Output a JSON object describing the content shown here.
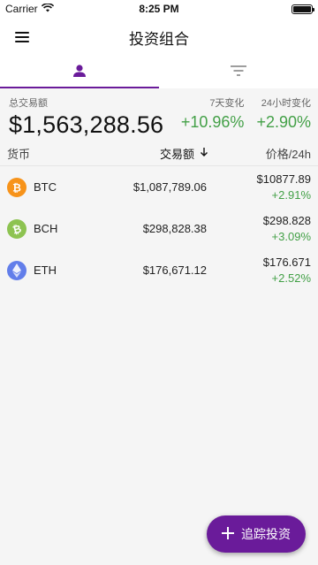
{
  "status_bar": {
    "carrier": "Carrier",
    "time": "8:25 PM"
  },
  "app_bar": {
    "title": "投资组合"
  },
  "tabs": [
    {
      "icon": "person-icon",
      "active": true
    },
    {
      "icon": "filter-icon",
      "active": false
    }
  ],
  "summary": {
    "total_label": "总交易额",
    "total_value": "$1,563,288.56",
    "change_7d_label": "7天变化",
    "change_7d_value": "+10.96%",
    "change_24h_label": "24小时变化",
    "change_24h_value": "+2.90%"
  },
  "table": {
    "headers": {
      "coin": "货币",
      "volume": "交易额",
      "price": "价格/24h"
    },
    "rows": [
      {
        "symbol": "BTC",
        "volume": "$1,087,789.06",
        "price": "$10877.89",
        "change": "+2.91%",
        "icon_color": "#f7931a",
        "icon": "bitcoin-icon"
      },
      {
        "symbol": "BCH",
        "volume": "$298,828.38",
        "price": "$298.828",
        "change": "+3.09%",
        "icon_color": "#8dc351",
        "icon": "bitcoin-cash-icon"
      },
      {
        "symbol": "ETH",
        "volume": "$176,671.12",
        "price": "$176.671",
        "change": "+2.52%",
        "icon_color": "#627eea",
        "icon": "ethereum-icon"
      }
    ]
  },
  "fab": {
    "label": "追踪投资"
  },
  "colors": {
    "accent": "#6a1b9a",
    "positive": "#43a047"
  }
}
